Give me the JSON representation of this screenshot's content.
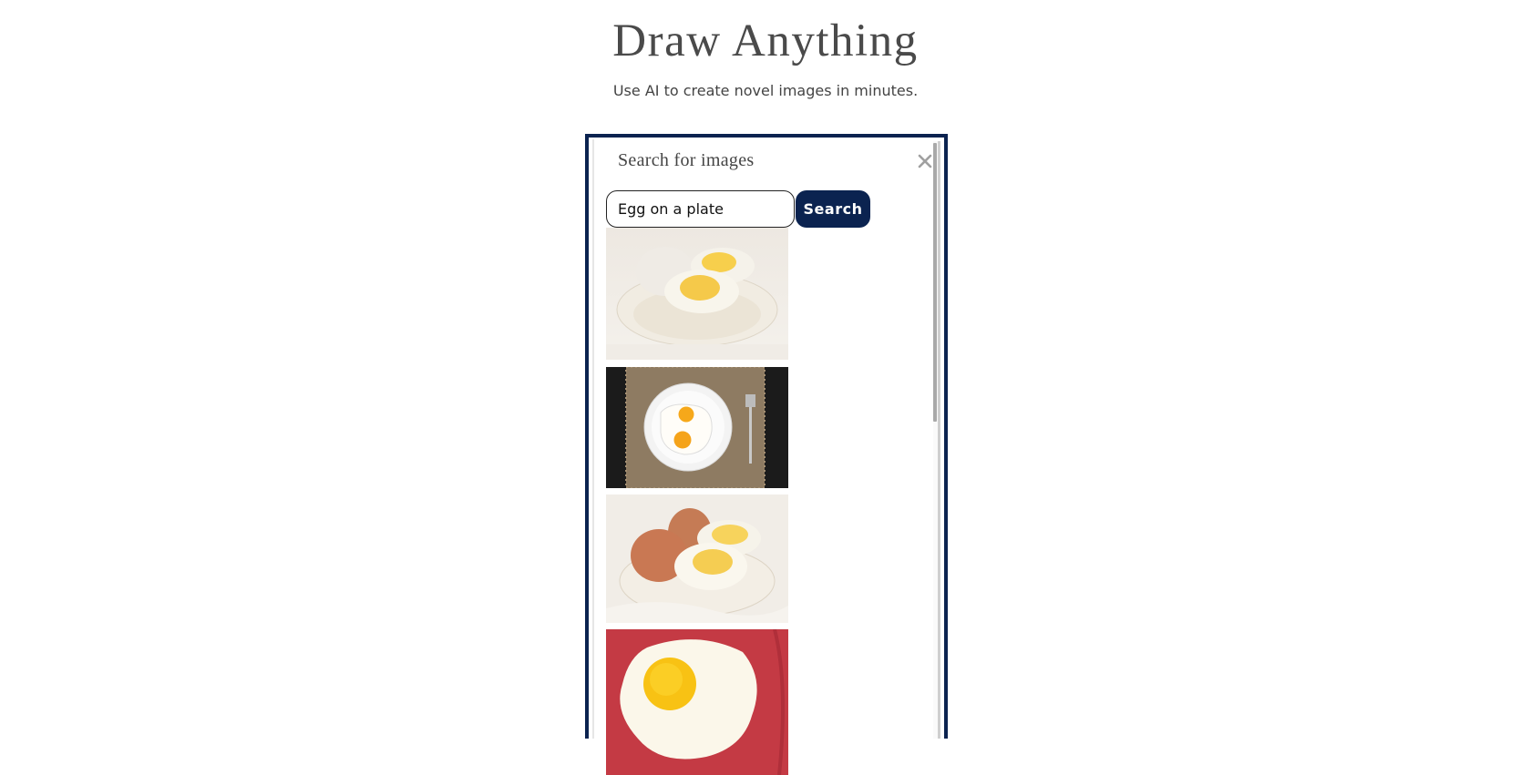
{
  "header": {
    "title": "Draw Anything",
    "subtitle": "Use AI to create novel images in minutes."
  },
  "dialog": {
    "title": "Search for images",
    "close_icon": "close-icon",
    "search": {
      "value": "Egg on a plate",
      "placeholder": "",
      "button_label": "Search"
    },
    "results": [
      {
        "description": "Two halved hard-boiled eggs and a whole white egg on a cream plate"
      },
      {
        "description": "Two fried eggs on a white plate on a burlap mat with a fork, dark background"
      },
      {
        "description": "Two brown eggs and a halved hard-boiled egg on a white plate"
      },
      {
        "description": "Single fried egg on a red plate"
      }
    ],
    "scroll_position": 0
  },
  "colors": {
    "accent": "#0b2350",
    "text": "#444444",
    "close": "#a0a0a0"
  }
}
